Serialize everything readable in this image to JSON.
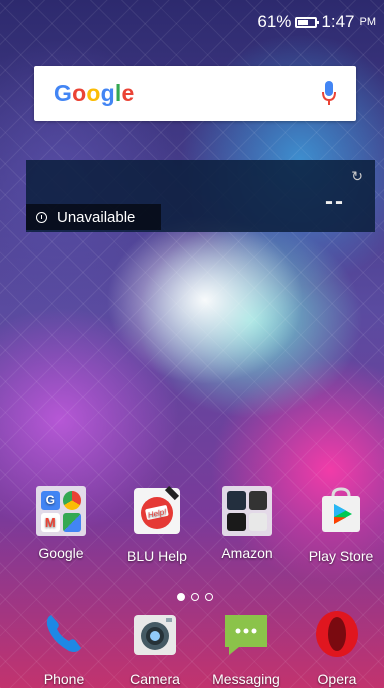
{
  "status_bar": {
    "battery_percent": "61%",
    "battery_level": 0.61,
    "time": "1:47",
    "ampm": "PM"
  },
  "search_widget": {
    "logo": "Google"
  },
  "weather_widget": {
    "status": "Unavailable",
    "temperature": "--"
  },
  "pager": {
    "pages": 3,
    "active": 0
  },
  "apps": [
    {
      "label": "Google"
    },
    {
      "label": "BLU Help"
    },
    {
      "label": "Amazon"
    },
    {
      "label": "Play Store"
    }
  ],
  "dock": [
    {
      "label": "Phone"
    },
    {
      "label": "Camera"
    },
    {
      "label": "Messaging"
    },
    {
      "label": "Opera"
    }
  ],
  "colors": {
    "google_blue": "#4285F4",
    "google_red": "#EA4335",
    "google_yellow": "#FBBC05",
    "google_green": "#34A853",
    "phone_blue": "#1e88e5",
    "messaging_green": "#8bc34a",
    "opera_red": "#e0161f"
  }
}
